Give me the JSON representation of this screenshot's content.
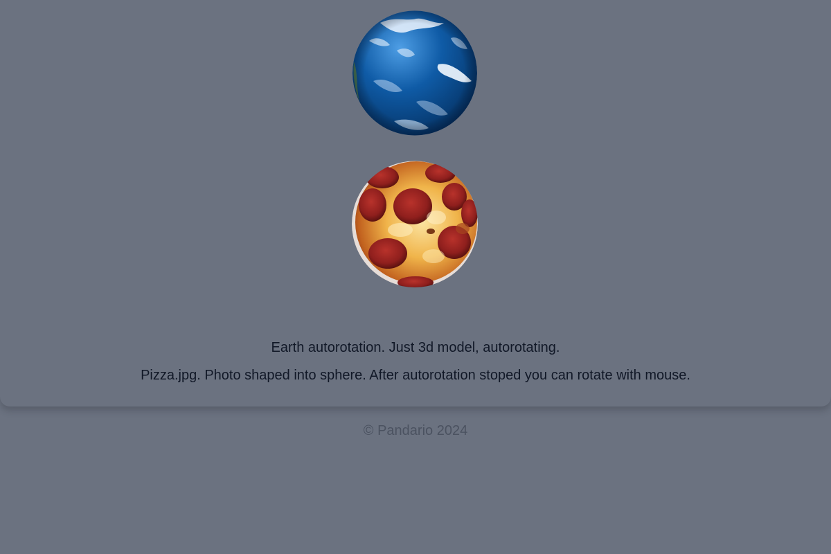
{
  "scene": {
    "background_color": "#6b7280",
    "card_color": "#6b7280",
    "earth_model": {
      "name": "earth-globe",
      "ocean_color": "#0f5ba6",
      "cloud_color": "#e9f4ff"
    },
    "pizza_model": {
      "name": "pizza-sphere",
      "cheese_color": "#f6c45b",
      "pepperoni_color": "#8f1f1d"
    }
  },
  "captions": {
    "earth": "Earth autorotation. Just 3d model, autorotating.",
    "pizza": "Pizza.jpg. Photo shaped into sphere. After autorotation stoped you can rotate with mouse."
  },
  "footer": {
    "text": "© Pandario 2024"
  }
}
